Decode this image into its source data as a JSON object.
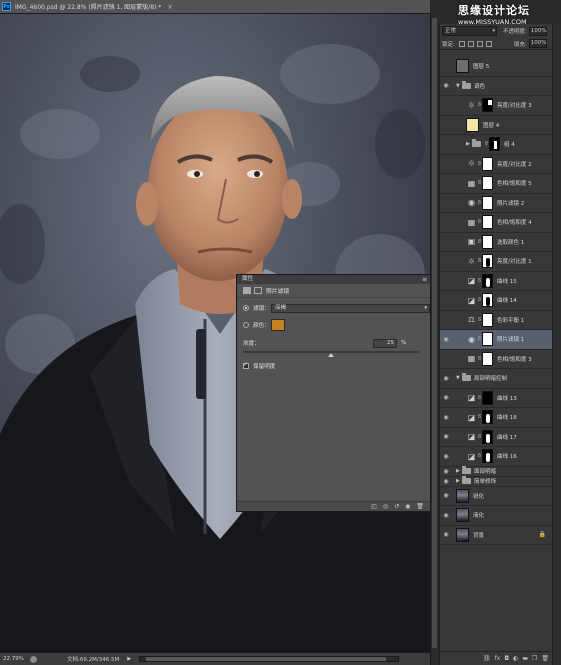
{
  "document": {
    "app_badge": "Ps",
    "title": "IMG_4600.psd @ 22.8% (照片滤镜 1, 图层蒙版/8) *",
    "close_glyph": "×"
  },
  "watermark": {
    "title": "思缘设计论坛",
    "url": "www.MISSYUAN.COM"
  },
  "status": {
    "zoom": "22.79%",
    "doc_size": "文档:69.2M/346.5M",
    "arrow": "▶"
  },
  "layers_panel": {
    "blend_mode": "正常",
    "opacity_label": "不透明度:",
    "opacity_value": "100%",
    "lock_label": "锁定:",
    "fill_label": "填充:",
    "fill_value": "100%",
    "layers": [
      {
        "name": "图层 5",
        "kind": "pixel-gray",
        "visible": false,
        "indent": 0
      },
      {
        "name": "调色",
        "kind": "group-open",
        "visible": true,
        "indent": 0
      },
      {
        "name": "亮度/对比度 3",
        "kind": "brightness",
        "mask": "black-white-corner",
        "visible": false,
        "indent": 1
      },
      {
        "name": "图层 4",
        "kind": "pixel-cream",
        "visible": false,
        "indent": 1
      },
      {
        "name": "组 4",
        "kind": "group-closed",
        "mask": "black-figure",
        "visible": false,
        "indent": 1
      },
      {
        "name": "亮度/对比度 2",
        "kind": "brightness",
        "mask": "white",
        "visible": false,
        "indent": 1
      },
      {
        "name": "色相/饱和度 5",
        "kind": "huesat",
        "mask": "white",
        "visible": false,
        "indent": 1
      },
      {
        "name": "照片滤镜 2",
        "kind": "photofilter",
        "mask": "white",
        "visible": false,
        "indent": 1
      },
      {
        "name": "色相/饱和度 4",
        "kind": "huesat",
        "mask": "white",
        "visible": false,
        "indent": 1
      },
      {
        "name": "选取颜色 1",
        "kind": "selective",
        "mask": "white",
        "visible": false,
        "indent": 1
      },
      {
        "name": "亮度/对比度 1",
        "kind": "brightness",
        "mask": "white-figure",
        "visible": false,
        "indent": 1
      },
      {
        "name": "曲线 15",
        "kind": "curves",
        "mask": "black-figure",
        "visible": false,
        "indent": 1
      },
      {
        "name": "曲线 14",
        "kind": "curves",
        "mask": "white-figure",
        "visible": false,
        "indent": 1
      },
      {
        "name": "色彩平衡 1",
        "kind": "balance",
        "mask": "white",
        "visible": false,
        "indent": 1
      },
      {
        "name": "照片滤镜 1",
        "kind": "photofilter",
        "mask": "white",
        "visible": true,
        "indent": 1,
        "selected": true
      },
      {
        "name": "色相/饱和度 3",
        "kind": "huesat",
        "mask": "white",
        "visible": false,
        "indent": 1
      },
      {
        "name": "局部明暗控制",
        "kind": "group-open",
        "visible": true,
        "indent": 0
      },
      {
        "name": "曲线 13",
        "kind": "curves",
        "mask": "black",
        "visible": true,
        "indent": 1
      },
      {
        "name": "曲线 18",
        "kind": "curves",
        "mask": "black-figure",
        "visible": true,
        "indent": 1
      },
      {
        "name": "曲线 17",
        "kind": "curves",
        "mask": "black-figure",
        "visible": true,
        "indent": 1
      },
      {
        "name": "曲线 16",
        "kind": "curves",
        "mask": "black-figure",
        "visible": true,
        "indent": 1
      },
      {
        "name": "面部明暗",
        "kind": "group-closed",
        "visible": true,
        "indent": 0,
        "short": true
      },
      {
        "name": "简单修饰",
        "kind": "group-closed",
        "visible": true,
        "indent": 0,
        "short": true
      },
      {
        "name": "锐化",
        "kind": "pixel-portrait",
        "visible": true,
        "indent": 0
      },
      {
        "name": "液化",
        "kind": "pixel-portrait",
        "visible": true,
        "indent": 0
      },
      {
        "name": "背景",
        "kind": "pixel-portrait",
        "visible": true,
        "indent": 0,
        "locked": true
      }
    ],
    "footer_icons": [
      "link-icon",
      "fx-icon",
      "mask-icon",
      "adjustment-icon",
      "folder-icon",
      "new-layer-icon",
      "trash-icon"
    ],
    "footer_glyphs": [
      "⛓",
      "fx",
      "◘",
      "◐",
      "▬",
      "❐",
      "🗑"
    ]
  },
  "properties": {
    "panel_title": "属性",
    "menu_glyph": "≡",
    "header": "照片滤镜",
    "filter_label": "滤镜：",
    "filter_value": "深褐",
    "color_label": "颜色：",
    "color_swatch": "#c6801f",
    "density_label": "浓度：",
    "density_value": "25",
    "density_unit": "%",
    "density_fraction": 0.25,
    "preserve_label": "保留明度",
    "footer_glyphs": [
      "◰",
      "◎",
      "↺",
      "◉",
      "🗑"
    ]
  }
}
